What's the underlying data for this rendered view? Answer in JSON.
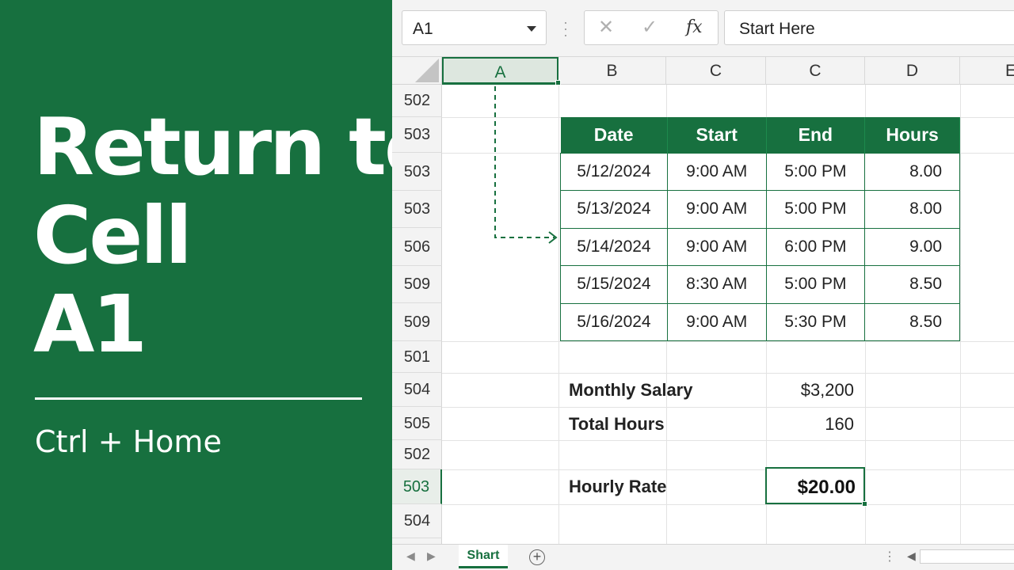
{
  "left_panel": {
    "title_lines": [
      "Return to",
      "Cell",
      "A1"
    ],
    "shortcut": "Ctrl + Home"
  },
  "formula_bar": {
    "name_box": "A1",
    "cancel_icon": "✕",
    "enter_icon": "✓",
    "fx": "fx",
    "formula": "Start Here"
  },
  "columns": [
    "A",
    "B",
    "C",
    "C",
    "D",
    "E"
  ],
  "rows": [
    "502",
    "503",
    "503",
    "503",
    "506",
    "509",
    "509",
    "501",
    "504",
    "505",
    "502",
    "503",
    "504"
  ],
  "table": {
    "headers": [
      "Date",
      "Start",
      "End",
      "Hours"
    ],
    "rows": [
      [
        "5/12/2024",
        "9:00 AM",
        "5:00 PM",
        "8.00"
      ],
      [
        "5/13/2024",
        "9:00 AM",
        "5:00 PM",
        "8.00"
      ],
      [
        "5/14/2024",
        "9:00 AM",
        "6:00 PM",
        "9.00"
      ],
      [
        "5/15/2024",
        "8:30 AM",
        "5:00 PM",
        "8.50"
      ],
      [
        "5/16/2024",
        "9:00 AM",
        "5:30 PM",
        "8.50"
      ]
    ]
  },
  "summary": {
    "salary_label": "Monthly Salary",
    "salary_value": "$3,200",
    "hours_label": "Total Hours",
    "hours_value": "160",
    "rate_label": "Hourly Rate",
    "rate_value": "$20.00"
  },
  "sheet_tabs": {
    "active": "Shart",
    "add": "+"
  },
  "colors": {
    "accent": "#17703f"
  }
}
